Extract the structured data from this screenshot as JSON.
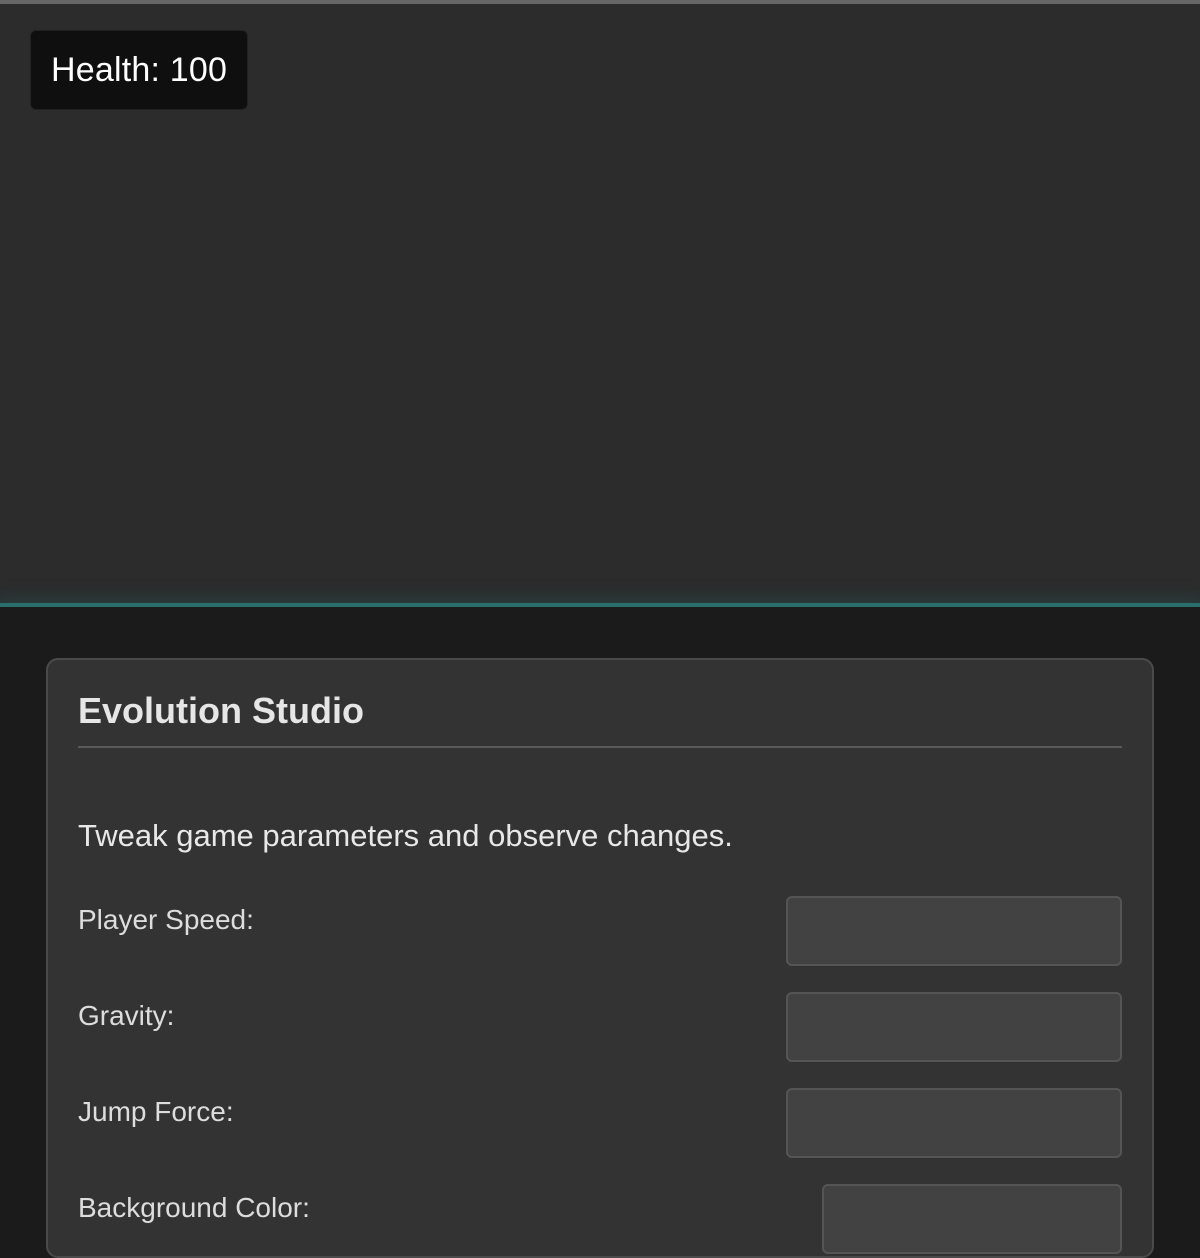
{
  "hud": {
    "health_text": "Health: 100"
  },
  "panel": {
    "title": "Evolution Studio",
    "description": "Tweak game parameters and observe changes.",
    "params": [
      {
        "label": "Player Speed:",
        "value": ""
      },
      {
        "label": "Gravity:",
        "value": ""
      },
      {
        "label": "Jump Force:",
        "value": ""
      },
      {
        "label": "Background Color:",
        "value": ""
      }
    ]
  },
  "colors": {
    "game_background": "#2c2c2c",
    "ground_accent": "#2a6f6c",
    "panel_background": "#333333",
    "page_background": "#1b1b1b"
  }
}
